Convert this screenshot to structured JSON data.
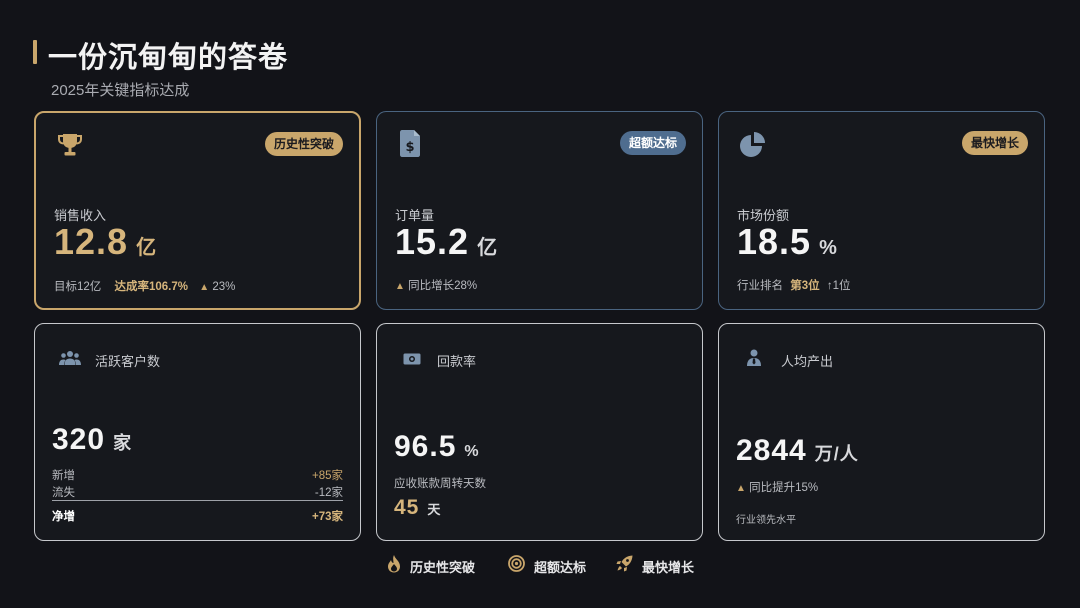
{
  "header": {
    "title": "一份沉甸甸的答卷",
    "subtitle": "2025年关键指标达成"
  },
  "colors": {
    "gold": "#c9a66b",
    "blue": "#4f6d8f",
    "background": "#121318"
  },
  "cards": [
    {
      "icon": "trophy-icon",
      "badge": "历史性突破",
      "label": "销售收入",
      "value": "12.8",
      "unit": "亿",
      "foot_target": "目标12亿",
      "foot_rate": "达成率106.7%",
      "foot_growth": "23%"
    },
    {
      "icon": "invoice-icon",
      "badge": "超额达标",
      "label": "订单量",
      "value": "15.2",
      "unit": "亿",
      "foot_growth": "同比增长28%"
    },
    {
      "icon": "pie-chart-icon",
      "badge": "最快增长",
      "label": "市场份额",
      "value": "18.5",
      "unit": "%",
      "foot_rank_label": "行业排名",
      "foot_rank_value": "第3位",
      "foot_rank_change": "↑1位"
    },
    {
      "icon": "users-icon",
      "label": "活跃客户数",
      "value": "320",
      "unit": "家",
      "rows": [
        {
          "label": "新增",
          "value": "+85家"
        },
        {
          "label": "流失",
          "value": "-12家"
        }
      ],
      "net_label": "净增",
      "net_value": "+73家"
    },
    {
      "icon": "money-icon",
      "label": "回款率",
      "value": "96.5",
      "unit": "%",
      "sub_label": "应收账款周转天数",
      "sub_value": "45",
      "sub_unit": "天"
    },
    {
      "icon": "person-icon",
      "label": "人均产出",
      "value": "2844",
      "unit": "万/人",
      "foot_growth": "同比提升15%",
      "foot_note": "行业领先水平"
    }
  ],
  "legend": [
    {
      "icon": "flame-icon",
      "label": "历史性突破"
    },
    {
      "icon": "target-icon",
      "label": "超额达标"
    },
    {
      "icon": "rocket-icon",
      "label": "最快增长"
    }
  ]
}
